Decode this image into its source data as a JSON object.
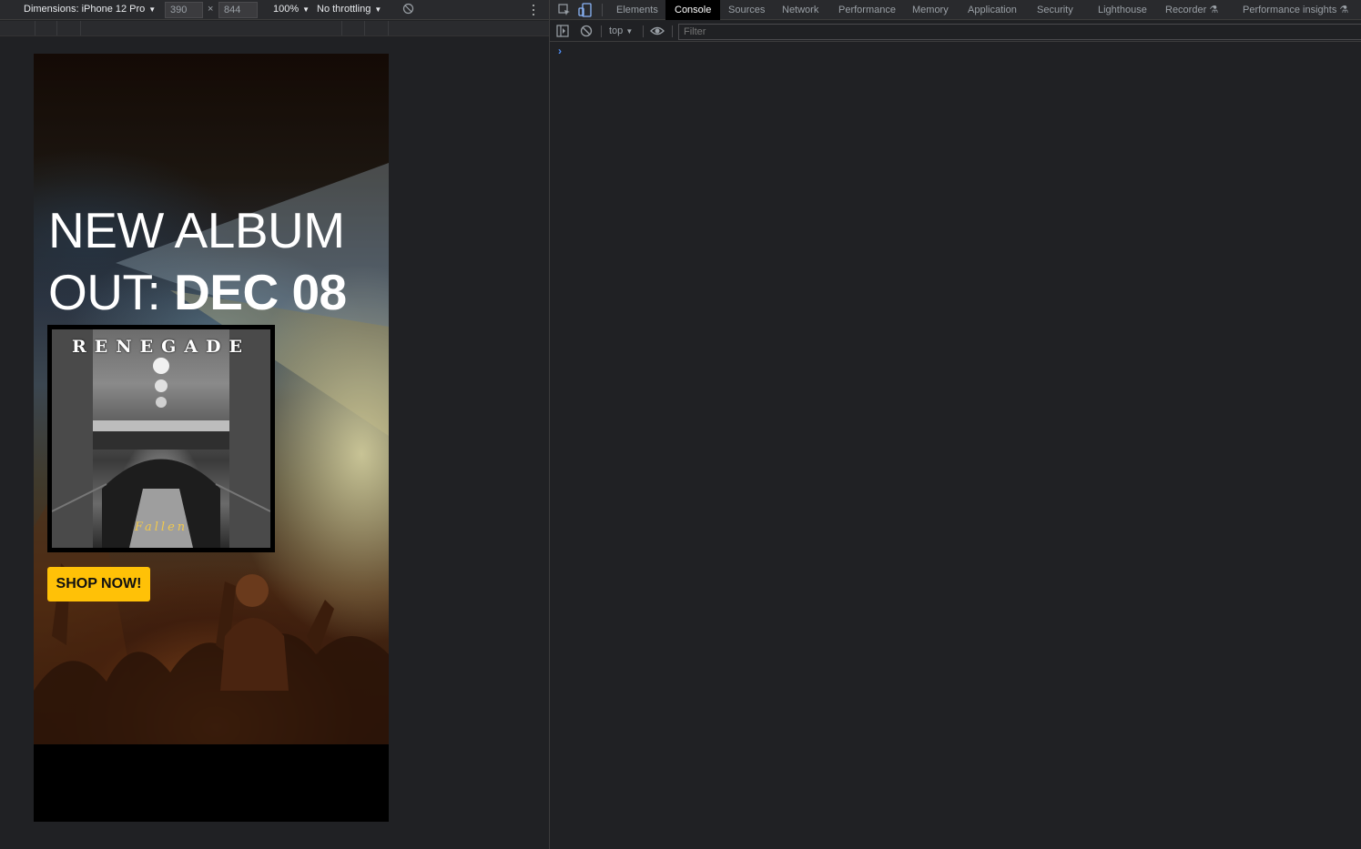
{
  "emulation": {
    "dimensions_label": "Dimensions: iPhone 12 Pro",
    "width": "390",
    "height": "844",
    "times": "×",
    "zoom": "100%",
    "throttling": "No throttling"
  },
  "page": {
    "headline_line1": "NEW ALBUM",
    "headline_prefix": "OUT: ",
    "headline_date": "DEC 08",
    "album_title": "RENEGADE",
    "album_subtitle": "Fallen",
    "shop_button": "SHOP NOW!"
  },
  "devtools": {
    "tabs": [
      {
        "label": "Elements"
      },
      {
        "label": "Console",
        "active": true
      },
      {
        "label": "Sources"
      },
      {
        "label": "Network"
      },
      {
        "label": "Performance"
      },
      {
        "label": "Memory"
      },
      {
        "label": "Application"
      },
      {
        "label": "Security"
      },
      {
        "label": "Lighthouse"
      },
      {
        "label": "Recorder"
      },
      {
        "label": "Performance insights"
      }
    ],
    "context": "top",
    "filter_placeholder": "Filter",
    "prompt": "›"
  },
  "colors": {
    "devtools_bg": "#202124",
    "toolbar_bg": "#292a2d",
    "accent_button": "#ffc107",
    "prompt_blue": "#4f8ef7"
  }
}
